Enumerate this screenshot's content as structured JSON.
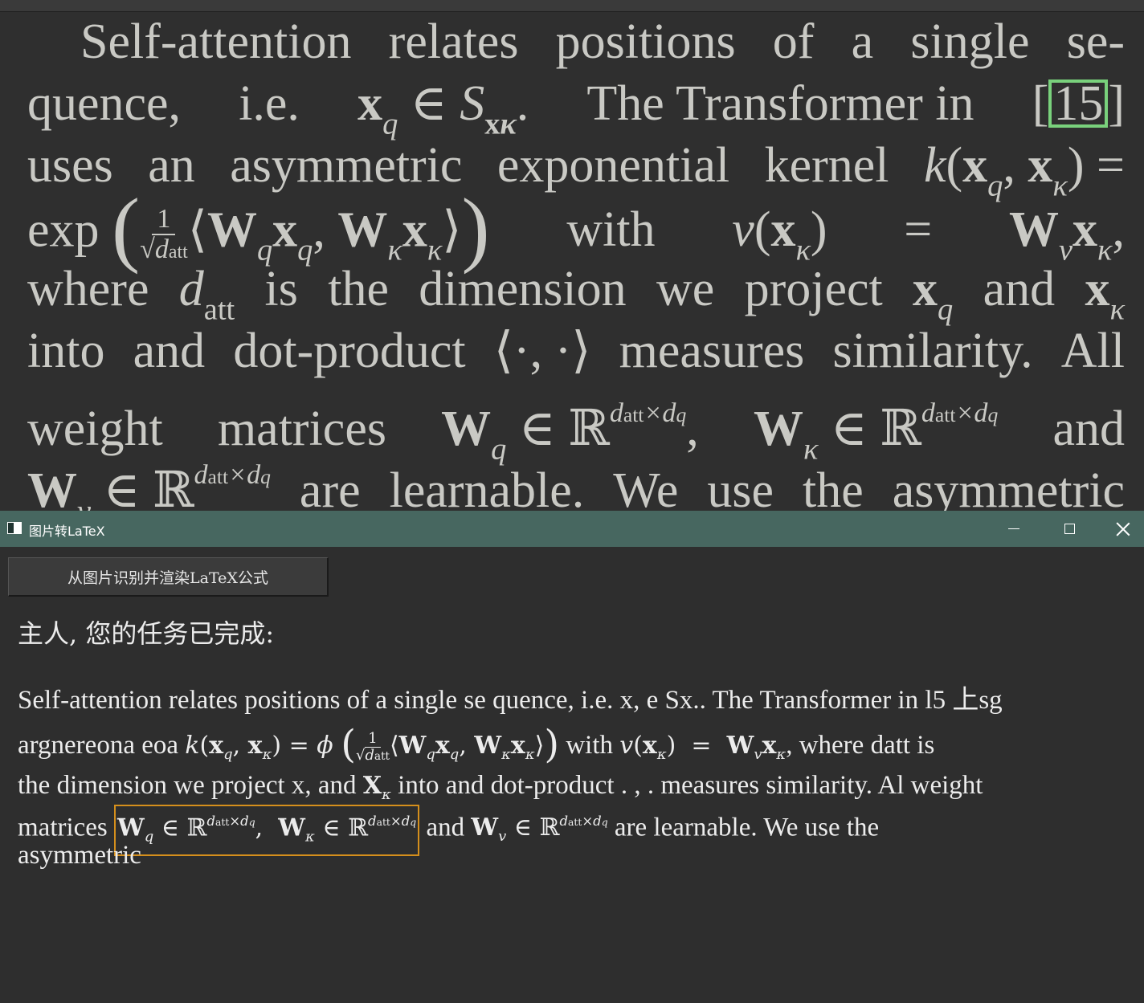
{
  "document": {
    "lines": [
      [
        "Self-attention",
        "relates",
        "positions",
        "of",
        "a",
        "single",
        "se-"
      ],
      [
        "quence,",
        "i.e."
      ],
      [
        "uses",
        "an",
        "asymmetric",
        "exponential",
        "kernel"
      ],
      [
        "with"
      ],
      [
        "where",
        "is",
        "the",
        "dimension",
        "we",
        "project",
        "and"
      ],
      [
        "into",
        "and",
        "dot-product",
        "measures",
        "similarity.",
        "All"
      ],
      [
        "weight",
        "matrices",
        "and"
      ],
      [
        "are",
        "learnable.",
        "We",
        "use",
        "the",
        "asymmetric"
      ]
    ],
    "the_transformer_in": "The Transformer in",
    "citation": "15",
    "exp_label": "exp"
  },
  "window": {
    "title": "图片转LaTeX",
    "minimize_icon": "minimize-icon",
    "maximize_icon": "maximize-icon",
    "close_icon": "close-icon"
  },
  "toolbar": {
    "recognize_button_label": "从图片识别并渲染LaTeX公式"
  },
  "result": {
    "heading": "主人, 您的任务已完成:",
    "line1": "Self-attention relates positions of a single se quence, i.e. x, e Sx.. The Transformer in l5 上sg",
    "line2_prefix": "argnereona eoa",
    "line2_with": "with",
    "line2_suffix": ", where datt is",
    "line3_prefix": "the dimension we project x, and",
    "line3_suffix": "into and dot-product . , . measures similarity. Al weight",
    "line4_prefix": "matrices",
    "line4_and": "and",
    "line4_suffix": "are learnable. We use the",
    "line5": "asymmetric"
  },
  "colors": {
    "titlebar": "#476760",
    "citation_box": "#79d17c",
    "highlight_box": "#d58f1c",
    "background": "#2e2e2e"
  }
}
